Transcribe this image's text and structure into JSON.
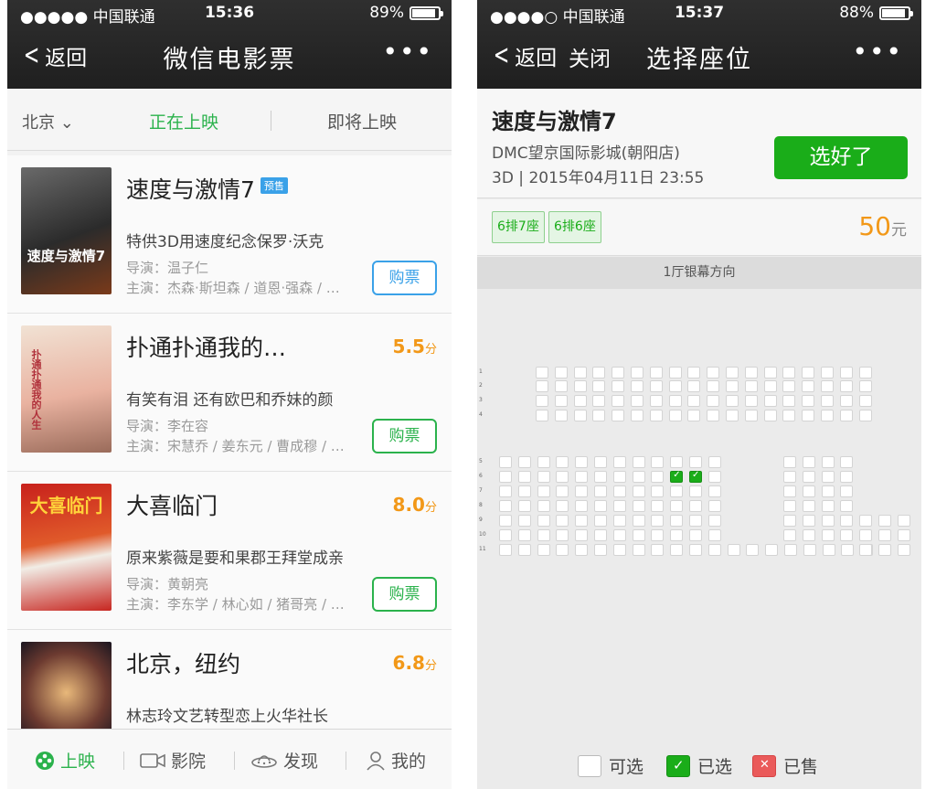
{
  "left": {
    "status": {
      "carrier": "●●●●● 中国联通",
      "time": "15:36",
      "battery": "89%",
      "battery_level": 0.89
    },
    "nav": {
      "back": "返回",
      "title": "微信电影票",
      "more": "•••"
    },
    "tabs": {
      "city": "北京",
      "now_showing": "正在上映",
      "coming_soon": "即将上映"
    },
    "movies": [
      {
        "title": "速度与激情7",
        "badge": "预售",
        "score": "",
        "score_unit": "",
        "desc": "特供3D用速度纪念保罗·沃克",
        "director": "导演：温子仁",
        "actors": "主演：杰森·斯坦森 / 道恩·强森 / …",
        "buy": "购票"
      },
      {
        "title": "扑通扑通我的…",
        "badge": "",
        "score": "5.5",
        "score_unit": "分",
        "desc": "有笑有泪 还有欧巴和乔妹的颜",
        "director": "导演：李在容",
        "actors": "主演：宋慧乔 / 姜东元 / 曹成穆 / …",
        "buy": "购票"
      },
      {
        "title": "大喜临门",
        "badge": "",
        "score": "8.0",
        "score_unit": "分",
        "desc": "原来紫薇是要和果郡王拜堂成亲",
        "director": "导演：黄朝亮",
        "actors": "主演：李东学 / 林心如 / 猪哥亮 / …",
        "buy": "购票"
      },
      {
        "title": "北京，纽约",
        "badge": "",
        "score": "6.8",
        "score_unit": "分",
        "desc": "林志玲文艺转型恋上火华社长",
        "director": "",
        "actors": "",
        "buy": ""
      }
    ],
    "poster_texts": [
      "速度与激情7",
      "扑通扑通我的人生",
      "大喜临门",
      ""
    ],
    "bottom_nav": {
      "showing": "上映",
      "cinema": "影院",
      "discover": "发现",
      "mine": "我的"
    }
  },
  "right": {
    "status": {
      "carrier": "●●●●○ 中国联通",
      "time": "15:37",
      "battery": "88%",
      "battery_level": 0.88
    },
    "nav": {
      "back": "返回",
      "close": "关闭",
      "title": "选择座位",
      "more": "•••"
    },
    "movie": {
      "title": "速度与激情7",
      "cinema": "DMC望京国际影城(朝阳店)",
      "showtime": "3D | 2015年04月11日 23:55",
      "confirm": "选好了"
    },
    "selected": [
      "6排7座",
      "6排6座"
    ],
    "price": "50",
    "price_unit": "元",
    "screen_label": "1厅银幕方向",
    "row_labels": [
      "1",
      "2",
      "3",
      "4",
      "5",
      "6",
      "7",
      "8",
      "9",
      "10",
      "11"
    ],
    "legend": {
      "available": "可选",
      "selected": "已选",
      "sold": "已售"
    },
    "colors": {
      "accent_green": "#1aad19",
      "score_orange": "#f29818",
      "sold_red": "#ea5a5a"
    }
  }
}
